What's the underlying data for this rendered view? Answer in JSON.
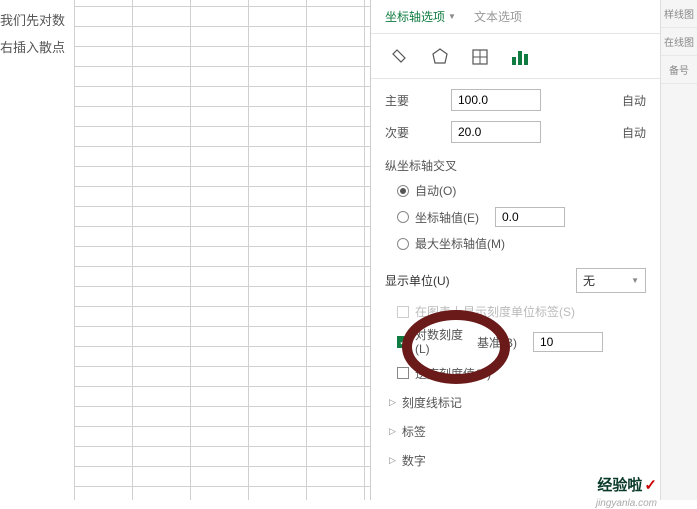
{
  "left_text": {
    "line1": "我们先对数",
    "line2": "右插入散点"
  },
  "task_pane": {
    "header": {
      "axis_options": "坐标轴选项",
      "text_options": "文本选项"
    },
    "major": {
      "label": "主要",
      "value": "100.0",
      "auto": "自动"
    },
    "minor": {
      "label": "次要",
      "value": "20.0",
      "auto": "自动"
    },
    "axis_cross": {
      "title": "纵坐标轴交叉",
      "auto": "自动(O)",
      "axis_value": "坐标轴值(E)",
      "axis_value_input": "0.0",
      "max_axis_value": "最大坐标轴值(M)"
    },
    "display_units": {
      "label": "显示单位(U)",
      "value": "无"
    },
    "show_units_label": "在图表上显示刻度单位标签(S)",
    "log_scale": {
      "label": "对数刻度(L)",
      "base_label": "基准(B)",
      "base_value": "10"
    },
    "reverse_order": "逆序刻度值(V)",
    "sections": {
      "tick_marks": "刻度线标记",
      "labels": "标签",
      "number": "数字"
    }
  },
  "right_strip": {
    "item1": "样线图",
    "item2": "在线图",
    "item3": "备号"
  },
  "watermark": {
    "ch": "经验啦",
    "tick": "✓",
    "sub": "jingyanla.com"
  }
}
